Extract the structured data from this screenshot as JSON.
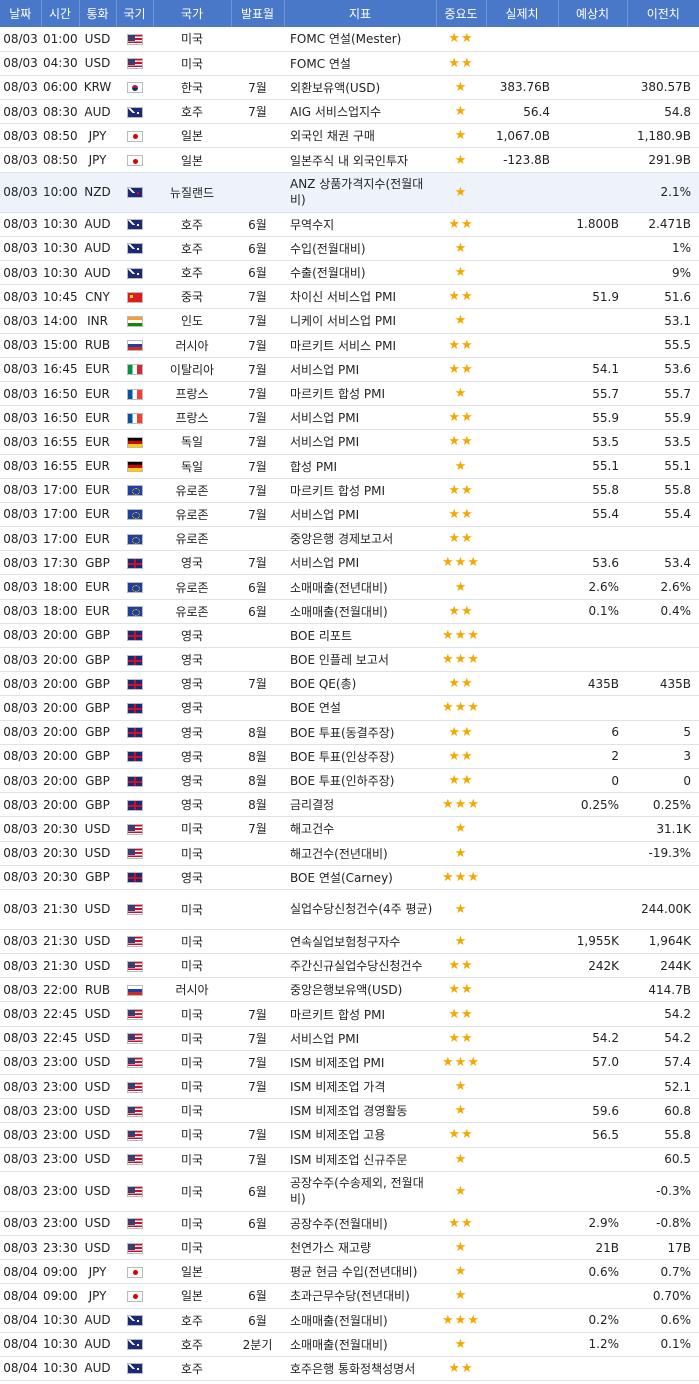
{
  "headers": [
    "날짜",
    "시간",
    "통화",
    "국기",
    "국가",
    "발표월",
    "지표",
    "중요도",
    "실제치",
    "예상치",
    "이전치"
  ],
  "rows": [
    {
      "date": "08/03",
      "time": "01:00",
      "cur": "USD",
      "flag": "us",
      "country": "미국",
      "month": "",
      "event": "FOMC 연설(Mester)",
      "stars": "★★",
      "actual": "",
      "forecast": "",
      "previous": ""
    },
    {
      "date": "08/03",
      "time": "04:30",
      "cur": "USD",
      "flag": "us",
      "country": "미국",
      "month": "",
      "event": "FOMC 연설",
      "stars": "★★",
      "actual": "",
      "forecast": "",
      "previous": ""
    },
    {
      "date": "08/03",
      "time": "06:00",
      "cur": "KRW",
      "flag": "kr",
      "country": "한국",
      "month": "7월",
      "event": "외환보유액(USD)",
      "stars": "★",
      "actual": "383.76B",
      "forecast": "",
      "previous": "380.57B"
    },
    {
      "date": "08/03",
      "time": "08:30",
      "cur": "AUD",
      "flag": "au",
      "country": "호주",
      "month": "7월",
      "event": "AIG 서비스업지수",
      "stars": "★",
      "actual": "56.4",
      "forecast": "",
      "previous": "54.8"
    },
    {
      "date": "08/03",
      "time": "08:50",
      "cur": "JPY",
      "flag": "jp",
      "country": "일본",
      "month": "",
      "event": "외국인 채권 구매",
      "stars": "★",
      "actual": "1,067.0B",
      "forecast": "",
      "previous": "1,180.9B"
    },
    {
      "date": "08/03",
      "time": "08:50",
      "cur": "JPY",
      "flag": "jp",
      "country": "일본",
      "month": "",
      "event": "일본주식 내 외국인투자",
      "stars": "★",
      "actual": "-123.8B",
      "forecast": "",
      "previous": "291.9B"
    },
    {
      "date": "08/03",
      "time": "10:00",
      "cur": "NZD",
      "flag": "nz",
      "country": "뉴질랜드",
      "month": "",
      "event": "ANZ 상품가격지수(전월대비)",
      "stars": "★",
      "actual": "",
      "forecast": "",
      "previous": "2.1%",
      "tall": true,
      "hl": true
    },
    {
      "date": "08/03",
      "time": "10:30",
      "cur": "AUD",
      "flag": "au",
      "country": "호주",
      "month": "6월",
      "event": "무역수지",
      "stars": "★★",
      "actual": "",
      "forecast": "1.800B",
      "previous": "2.471B"
    },
    {
      "date": "08/03",
      "time": "10:30",
      "cur": "AUD",
      "flag": "au",
      "country": "호주",
      "month": "6월",
      "event": "수입(전월대비)",
      "stars": "★",
      "actual": "",
      "forecast": "",
      "previous": "1%"
    },
    {
      "date": "08/03",
      "time": "10:30",
      "cur": "AUD",
      "flag": "au",
      "country": "호주",
      "month": "6월",
      "event": "수출(전월대비)",
      "stars": "★",
      "actual": "",
      "forecast": "",
      "previous": "9%"
    },
    {
      "date": "08/03",
      "time": "10:45",
      "cur": "CNY",
      "flag": "cn",
      "country": "중국",
      "month": "7월",
      "event": "차이신 서비스업 PMI",
      "stars": "★★",
      "actual": "",
      "forecast": "51.9",
      "previous": "51.6"
    },
    {
      "date": "08/03",
      "time": "14:00",
      "cur": "INR",
      "flag": "in",
      "country": "인도",
      "month": "7월",
      "event": "니케이 서비스업 PMI",
      "stars": "★",
      "actual": "",
      "forecast": "",
      "previous": "53.1"
    },
    {
      "date": "08/03",
      "time": "15:00",
      "cur": "RUB",
      "flag": "ru",
      "country": "러시아",
      "month": "7월",
      "event": "마르키트 서비스 PMI",
      "stars": "★★",
      "actual": "",
      "forecast": "",
      "previous": "55.5"
    },
    {
      "date": "08/03",
      "time": "16:45",
      "cur": "EUR",
      "flag": "it",
      "country": "이탈리아",
      "month": "7월",
      "event": "서비스업 PMI",
      "stars": "★★",
      "actual": "",
      "forecast": "54.1",
      "previous": "53.6"
    },
    {
      "date": "08/03",
      "time": "16:50",
      "cur": "EUR",
      "flag": "fr",
      "country": "프랑스",
      "month": "7월",
      "event": "마르키트 합성 PMI",
      "stars": "★",
      "actual": "",
      "forecast": "55.7",
      "previous": "55.7"
    },
    {
      "date": "08/03",
      "time": "16:50",
      "cur": "EUR",
      "flag": "fr",
      "country": "프랑스",
      "month": "7월",
      "event": "서비스업 PMI",
      "stars": "★★",
      "actual": "",
      "forecast": "55.9",
      "previous": "55.9"
    },
    {
      "date": "08/03",
      "time": "16:55",
      "cur": "EUR",
      "flag": "de",
      "country": "독일",
      "month": "7월",
      "event": "서비스업 PMI",
      "stars": "★★",
      "actual": "",
      "forecast": "53.5",
      "previous": "53.5"
    },
    {
      "date": "08/03",
      "time": "16:55",
      "cur": "EUR",
      "flag": "de",
      "country": "독일",
      "month": "7월",
      "event": "합성 PMI",
      "stars": "★",
      "actual": "",
      "forecast": "55.1",
      "previous": "55.1"
    },
    {
      "date": "08/03",
      "time": "17:00",
      "cur": "EUR",
      "flag": "eu",
      "country": "유로존",
      "month": "7월",
      "event": "마르키트 합성 PMI",
      "stars": "★★",
      "actual": "",
      "forecast": "55.8",
      "previous": "55.8"
    },
    {
      "date": "08/03",
      "time": "17:00",
      "cur": "EUR",
      "flag": "eu",
      "country": "유로존",
      "month": "7월",
      "event": "서비스업 PMI",
      "stars": "★★",
      "actual": "",
      "forecast": "55.4",
      "previous": "55.4"
    },
    {
      "date": "08/03",
      "time": "17:00",
      "cur": "EUR",
      "flag": "eu",
      "country": "유로존",
      "month": "",
      "event": "중앙은행 경제보고서",
      "stars": "★★",
      "actual": "",
      "forecast": "",
      "previous": ""
    },
    {
      "date": "08/03",
      "time": "17:30",
      "cur": "GBP",
      "flag": "gb",
      "country": "영국",
      "month": "7월",
      "event": "서비스업 PMI",
      "stars": "★★★",
      "actual": "",
      "forecast": "53.6",
      "previous": "53.4"
    },
    {
      "date": "08/03",
      "time": "18:00",
      "cur": "EUR",
      "flag": "eu",
      "country": "유로존",
      "month": "6월",
      "event": "소매매출(전년대비)",
      "stars": "★",
      "actual": "",
      "forecast": "2.6%",
      "previous": "2.6%"
    },
    {
      "date": "08/03",
      "time": "18:00",
      "cur": "EUR",
      "flag": "eu",
      "country": "유로존",
      "month": "6월",
      "event": "소매매출(전월대비)",
      "stars": "★★",
      "actual": "",
      "forecast": "0.1%",
      "previous": "0.4%"
    },
    {
      "date": "08/03",
      "time": "20:00",
      "cur": "GBP",
      "flag": "gb",
      "country": "영국",
      "month": "",
      "event": "BOE 리포트",
      "stars": "★★★",
      "actual": "",
      "forecast": "",
      "previous": ""
    },
    {
      "date": "08/03",
      "time": "20:00",
      "cur": "GBP",
      "flag": "gb",
      "country": "영국",
      "month": "",
      "event": "BOE 인플레 보고서",
      "stars": "★★★",
      "actual": "",
      "forecast": "",
      "previous": ""
    },
    {
      "date": "08/03",
      "time": "20:00",
      "cur": "GBP",
      "flag": "gb",
      "country": "영국",
      "month": "7월",
      "event": "BOE QE(총)",
      "stars": "★★",
      "actual": "",
      "forecast": "435B",
      "previous": "435B"
    },
    {
      "date": "08/03",
      "time": "20:00",
      "cur": "GBP",
      "flag": "gb",
      "country": "영국",
      "month": "",
      "event": "BOE 연설",
      "stars": "★★★",
      "actual": "",
      "forecast": "",
      "previous": ""
    },
    {
      "date": "08/03",
      "time": "20:00",
      "cur": "GBP",
      "flag": "gb",
      "country": "영국",
      "month": "8월",
      "event": "BOE 투표(동결주장)",
      "stars": "★★",
      "actual": "",
      "forecast": "6",
      "previous": "5"
    },
    {
      "date": "08/03",
      "time": "20:00",
      "cur": "GBP",
      "flag": "gb",
      "country": "영국",
      "month": "8월",
      "event": "BOE 투표(인상주장)",
      "stars": "★★",
      "actual": "",
      "forecast": "2",
      "previous": "3"
    },
    {
      "date": "08/03",
      "time": "20:00",
      "cur": "GBP",
      "flag": "gb",
      "country": "영국",
      "month": "8월",
      "event": "BOE 투표(인하주장)",
      "stars": "★★",
      "actual": "",
      "forecast": "0",
      "previous": "0"
    },
    {
      "date": "08/03",
      "time": "20:00",
      "cur": "GBP",
      "flag": "gb",
      "country": "영국",
      "month": "8월",
      "event": "금리결정",
      "stars": "★★★",
      "actual": "",
      "forecast": "0.25%",
      "previous": "0.25%"
    },
    {
      "date": "08/03",
      "time": "20:30",
      "cur": "USD",
      "flag": "us",
      "country": "미국",
      "month": "7월",
      "event": "해고건수",
      "stars": "★",
      "actual": "",
      "forecast": "",
      "previous": "31.1K"
    },
    {
      "date": "08/03",
      "time": "20:30",
      "cur": "USD",
      "flag": "us",
      "country": "미국",
      "month": "",
      "event": "해고건수(전년대비)",
      "stars": "★",
      "actual": "",
      "forecast": "",
      "previous": "-19.3%"
    },
    {
      "date": "08/03",
      "time": "20:30",
      "cur": "GBP",
      "flag": "gb",
      "country": "영국",
      "month": "",
      "event": "BOE 연설(Carney)",
      "stars": "★★★",
      "actual": "",
      "forecast": "",
      "previous": ""
    },
    {
      "date": "08/03",
      "time": "21:30",
      "cur": "USD",
      "flag": "us",
      "country": "미국",
      "month": "",
      "event": "실업수당신청건수(4주 평균)",
      "stars": "★",
      "actual": "",
      "forecast": "",
      "previous": "244.00K",
      "tall": true
    },
    {
      "date": "08/03",
      "time": "21:30",
      "cur": "USD",
      "flag": "us",
      "country": "미국",
      "month": "",
      "event": "연속실업보험청구자수",
      "stars": "★",
      "actual": "",
      "forecast": "1,955K",
      "previous": "1,964K"
    },
    {
      "date": "08/03",
      "time": "21:30",
      "cur": "USD",
      "flag": "us",
      "country": "미국",
      "month": "",
      "event": "주간신규실업수당신청건수",
      "stars": "★★",
      "actual": "",
      "forecast": "242K",
      "previous": "244K"
    },
    {
      "date": "08/03",
      "time": "22:00",
      "cur": "RUB",
      "flag": "ru",
      "country": "러시아",
      "month": "",
      "event": "중앙은행보유액(USD)",
      "stars": "★★",
      "actual": "",
      "forecast": "",
      "previous": "414.7B"
    },
    {
      "date": "08/03",
      "time": "22:45",
      "cur": "USD",
      "flag": "us",
      "country": "미국",
      "month": "7월",
      "event": "마르키트 합성 PMI",
      "stars": "★★",
      "actual": "",
      "forecast": "",
      "previous": "54.2"
    },
    {
      "date": "08/03",
      "time": "22:45",
      "cur": "USD",
      "flag": "us",
      "country": "미국",
      "month": "7월",
      "event": "서비스업 PMI",
      "stars": "★★",
      "actual": "",
      "forecast": "54.2",
      "previous": "54.2"
    },
    {
      "date": "08/03",
      "time": "23:00",
      "cur": "USD",
      "flag": "us",
      "country": "미국",
      "month": "7월",
      "event": "ISM 비제조업 PMI",
      "stars": "★★★",
      "actual": "",
      "forecast": "57.0",
      "previous": "57.4"
    },
    {
      "date": "08/03",
      "time": "23:00",
      "cur": "USD",
      "flag": "us",
      "country": "미국",
      "month": "7월",
      "event": "ISM 비제조업 가격",
      "stars": "★",
      "actual": "",
      "forecast": "",
      "previous": "52.1"
    },
    {
      "date": "08/03",
      "time": "23:00",
      "cur": "USD",
      "flag": "us",
      "country": "미국",
      "month": "",
      "event": "ISM 비제조업 경영활동",
      "stars": "★",
      "actual": "",
      "forecast": "59.6",
      "previous": "60.8"
    },
    {
      "date": "08/03",
      "time": "23:00",
      "cur": "USD",
      "flag": "us",
      "country": "미국",
      "month": "7월",
      "event": "ISM 비제조업 고용",
      "stars": "★★",
      "actual": "",
      "forecast": "56.5",
      "previous": "55.8"
    },
    {
      "date": "08/03",
      "time": "23:00",
      "cur": "USD",
      "flag": "us",
      "country": "미국",
      "month": "7월",
      "event": "ISM 비제조업 신규주문",
      "stars": "★",
      "actual": "",
      "forecast": "",
      "previous": "60.5"
    },
    {
      "date": "08/03",
      "time": "23:00",
      "cur": "USD",
      "flag": "us",
      "country": "미국",
      "month": "6월",
      "event": "공장수주(수송제외, 전월대비)",
      "stars": "★",
      "actual": "",
      "forecast": "",
      "previous": "-0.3%",
      "tall": true
    },
    {
      "date": "08/03",
      "time": "23:00",
      "cur": "USD",
      "flag": "us",
      "country": "미국",
      "month": "6월",
      "event": "공장수주(전월대비)",
      "stars": "★★",
      "actual": "",
      "forecast": "2.9%",
      "previous": "-0.8%"
    },
    {
      "date": "08/03",
      "time": "23:30",
      "cur": "USD",
      "flag": "us",
      "country": "미국",
      "month": "",
      "event": "천연가스 재고량",
      "stars": "★",
      "actual": "",
      "forecast": "21B",
      "previous": "17B"
    },
    {
      "date": "08/04",
      "time": "09:00",
      "cur": "JPY",
      "flag": "jp",
      "country": "일본",
      "month": "",
      "event": "평균 현금 수입(전년대비)",
      "stars": "★",
      "actual": "",
      "forecast": "0.6%",
      "previous": "0.7%"
    },
    {
      "date": "08/04",
      "time": "09:00",
      "cur": "JPY",
      "flag": "jp",
      "country": "일본",
      "month": "6월",
      "event": "초과근무수당(전년대비)",
      "stars": "★",
      "actual": "",
      "forecast": "",
      "previous": "0.70%"
    },
    {
      "date": "08/04",
      "time": "10:30",
      "cur": "AUD",
      "flag": "au",
      "country": "호주",
      "month": "6월",
      "event": "소매매출(전월대비)",
      "stars": "★★★",
      "actual": "",
      "forecast": "0.2%",
      "previous": "0.6%"
    },
    {
      "date": "08/04",
      "time": "10:30",
      "cur": "AUD",
      "flag": "au",
      "country": "호주",
      "month": "2분기",
      "event": "소매매출(전월대비)",
      "stars": "★",
      "actual": "",
      "forecast": "1.2%",
      "previous": "0.1%"
    },
    {
      "date": "08/04",
      "time": "10:30",
      "cur": "AUD",
      "flag": "au",
      "country": "호주",
      "month": "",
      "event": "호주은행 통화정책성명서",
      "stars": "★★",
      "actual": "",
      "forecast": "",
      "previous": ""
    }
  ]
}
